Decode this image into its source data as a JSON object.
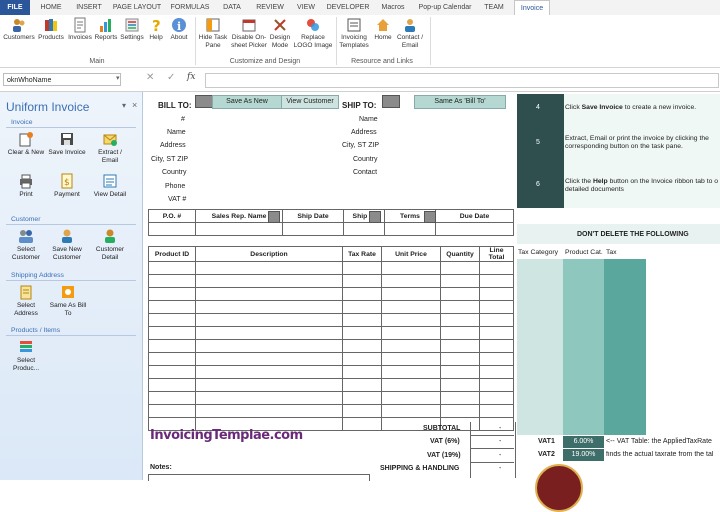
{
  "ribbon": {
    "tabs": [
      {
        "label": "FILE"
      },
      {
        "label": "HOME"
      },
      {
        "label": "INSERT"
      },
      {
        "label": "PAGE LAYOUT"
      },
      {
        "label": "FORMULAS"
      },
      {
        "label": "DATA"
      },
      {
        "label": "REVIEW"
      },
      {
        "label": "VIEW"
      },
      {
        "label": "DEVELOPER"
      },
      {
        "label": "Macros"
      },
      {
        "label": "Pop-up Calendar"
      },
      {
        "label": "TEAM"
      },
      {
        "label": "Invoice"
      }
    ],
    "main_buttons": [
      {
        "label": "Customers",
        "icon": "customers-icon"
      },
      {
        "label": "Products",
        "icon": "products-icon"
      },
      {
        "label": "Invoices",
        "icon": "invoices-icon"
      },
      {
        "label": "Reports",
        "icon": "reports-icon"
      },
      {
        "label": "Settings",
        "icon": "settings-icon"
      },
      {
        "label": "Help",
        "icon": "help-icon"
      },
      {
        "label": "About",
        "icon": "about-icon"
      }
    ],
    "customize_buttons": [
      {
        "line1": "Hide Task",
        "line2": "Pane"
      },
      {
        "line1": "Disable On-",
        "line2": "sheet Picker"
      },
      {
        "line1": "Design",
        "line2": "Mode"
      },
      {
        "line1": "Replace",
        "line2": "LOGO Image"
      }
    ],
    "resource_buttons": [
      {
        "line1": "Invoicing",
        "line2": "Templates"
      },
      {
        "line1": "Home",
        "line2": ""
      },
      {
        "line1": "Contact /",
        "line2": "Email"
      }
    ],
    "groups": {
      "main": "Main",
      "customize": "Customize and Design",
      "resources": "Resource and Links"
    }
  },
  "formula_bar": {
    "name_box": "oknWhoName",
    "fx": "fx",
    "cancel": "✕",
    "enter": "✓"
  },
  "task_pane": {
    "title": "Uniform Invoice",
    "sections": {
      "invoice": "Invoice",
      "customer": "Customer",
      "shipping": "Shipping Address",
      "products": "Products / Items"
    },
    "invoice_buttons": [
      {
        "line1": "Clear & New",
        "line2": ""
      },
      {
        "line1": "Save Invoice",
        "line2": ""
      },
      {
        "line1": "Extract /",
        "line2": "Email"
      },
      {
        "line1": "Print",
        "line2": ""
      },
      {
        "line1": "Payment",
        "line2": ""
      },
      {
        "line1": "View Detail",
        "line2": ""
      }
    ],
    "customer_buttons": [
      {
        "line1": "Select",
        "line2": "Customer"
      },
      {
        "line1": "Save New",
        "line2": "Customer"
      },
      {
        "line1": "Customer",
        "line2": "Detail"
      }
    ],
    "shipping_buttons": [
      {
        "line1": "Select",
        "line2": "Address"
      },
      {
        "line1": "Same As Bill",
        "line2": "To"
      }
    ],
    "product_buttons": [
      {
        "line1": "Select",
        "line2": "Produc..."
      }
    ]
  },
  "bill_to": {
    "title": "BILL TO:",
    "save_as_new": "Save As New",
    "view_customer": "View Customer",
    "fields": [
      "#",
      "Name",
      "Address",
      "City, ST ZIP",
      "Country",
      "Phone",
      "VAT #"
    ]
  },
  "ship_to": {
    "title": "SHIP TO:",
    "same_as": "Same As 'Bill To'",
    "fields": [
      "Name",
      "Address",
      "City, ST ZIP",
      "Country",
      "Contact"
    ]
  },
  "order_headers": [
    "P.O. #",
    "Sales Rep. Name",
    "Ship Date",
    "Ship Vi",
    "Terms",
    "Due Date"
  ],
  "item_headers": [
    "Product ID",
    "Description",
    "Tax Rate",
    "Unit Price",
    "Quantity",
    "Line Total"
  ],
  "totals": [
    {
      "label": "SUBTOTAL",
      "value": "-"
    },
    {
      "label": "VAT (6%)",
      "value": "-"
    },
    {
      "label": "VAT (19%)",
      "value": "-"
    },
    {
      "label": "SHIPPING & HANDLING",
      "value": "-"
    }
  ],
  "logo_text": "InvoicingTemplae.com",
  "notes_label": "Notes:",
  "instructions": [
    {
      "num": "4",
      "text_a": "Click ",
      "bold": "Save Invoice",
      "text_b": " to create a new invoice."
    },
    {
      "num": "5",
      "text_a": "Extract, Email or print the invoice by clicking the corresponding button on the task pane.",
      "bold": "",
      "text_b": ""
    },
    {
      "num": "6",
      "text_a": "Click the ",
      "bold": "Help",
      "text_b": " button on the Invoice ribbon tab to o detailed documents"
    }
  ],
  "dont_delete": "DON'T DELETE THE FOLLOWING",
  "tax_headers": [
    "Tax Category",
    "Product Cat.",
    "Tax"
  ],
  "vat_rows": [
    {
      "label": "VAT1",
      "rate": "6.00%",
      "note": "<-- VAT Table: the AppliedTaxRate"
    },
    {
      "label": "VAT2",
      "rate": "19.00%",
      "note": "finds the actual taxrate from the tal"
    }
  ]
}
